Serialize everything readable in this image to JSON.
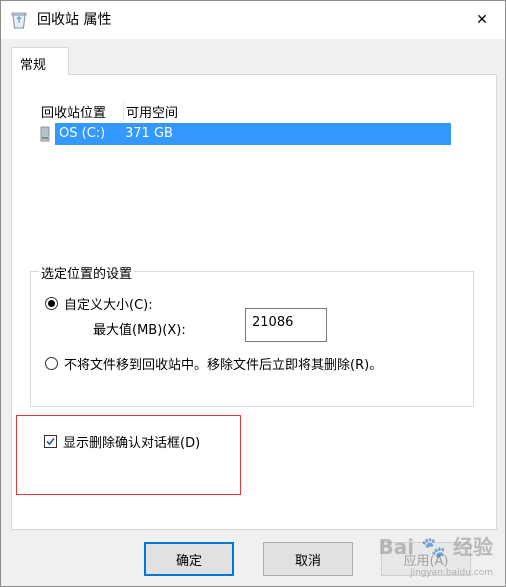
{
  "window": {
    "title": "回收站 属性",
    "close_label": "✕"
  },
  "tabs": [
    {
      "label": "常规"
    }
  ],
  "list": {
    "columns": [
      "回收站位置",
      "可用空间"
    ],
    "rows": [
      {
        "location": "OS (C:)",
        "space": "371 GB",
        "selected": true
      }
    ]
  },
  "settings": {
    "group_label": "选定位置的设置",
    "custom_size_label": "自定义大小(C):",
    "custom_size_checked": true,
    "max_label": "最大值(MB)(X):",
    "max_value": "21086",
    "no_move_label": "不将文件移到回收站中。移除文件后立即将其删除(R)。",
    "no_move_checked": false
  },
  "confirm": {
    "label": "显示删除确认对话框(D)",
    "checked": true
  },
  "buttons": {
    "ok": "确定",
    "cancel": "取消",
    "apply": "应用(A)"
  },
  "watermark": {
    "brand": "Bai",
    "brand2": "经验",
    "site": "jingyan.baidu.com"
  },
  "colors": {
    "selection": "#3399ff",
    "highlight_box": "#e23b3b",
    "default_button_border": "#0078d7"
  }
}
